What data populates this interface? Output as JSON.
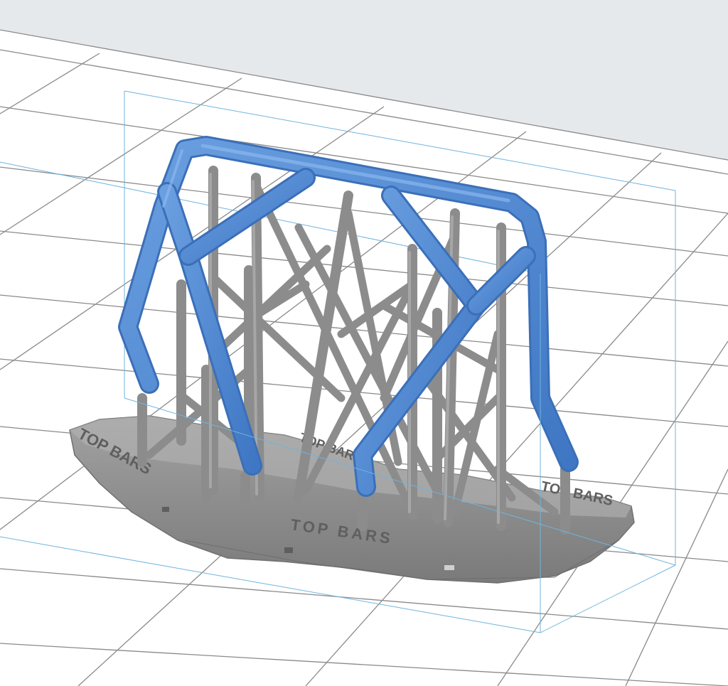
{
  "viewport": {
    "background_color": "#ffffff",
    "backdrop_color": "#e6e9ec",
    "grid_color": "#8a8a8a",
    "bounding_box_color": "#6fb4dd"
  },
  "model": {
    "base_color": "#8e8e8e",
    "support_color": "#8c8c8c",
    "bar_color": "#4a86d4",
    "base_engravings": [
      "TOP BARS",
      "TOP BARS",
      "TOP BARS",
      "TOP BARS"
    ]
  }
}
